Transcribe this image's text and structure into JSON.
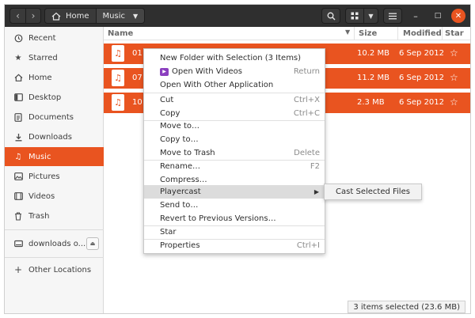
{
  "header": {
    "crumbs": [
      {
        "label": "Home",
        "icon": "home-icon"
      },
      {
        "label": "Music",
        "icon": "chevron-down-icon"
      }
    ]
  },
  "sidebar": {
    "items": [
      {
        "label": "Recent",
        "icon": "clock-icon"
      },
      {
        "label": "Starred",
        "icon": "star-icon"
      },
      {
        "label": "Home",
        "icon": "home-icon"
      },
      {
        "label": "Desktop",
        "icon": "desktop-icon"
      },
      {
        "label": "Documents",
        "icon": "document-icon"
      },
      {
        "label": "Downloads",
        "icon": "download-icon"
      },
      {
        "label": "Music",
        "icon": "music-note-icon",
        "active": true
      },
      {
        "label": "Pictures",
        "icon": "picture-icon"
      },
      {
        "label": "Videos",
        "icon": "video-icon"
      },
      {
        "label": "Trash",
        "icon": "trash-icon"
      }
    ],
    "drive": {
      "label": "downloads o...",
      "icon": "drive-icon"
    },
    "other": {
      "label": "Other Locations",
      "icon": "plus-icon"
    }
  },
  "columns": {
    "name": "Name",
    "size": "Size",
    "modified": "Modified",
    "star": "Star"
  },
  "files": [
    {
      "name": "01 - ",
      "size": "10.2 MB",
      "modified": "6 Sep 2012"
    },
    {
      "name": "07 - ",
      "size": "11.2 MB",
      "modified": "6 Sep 2012"
    },
    {
      "name": "10 - ",
      "size": "2.3 MB",
      "modified": "6 Sep 2012"
    }
  ],
  "context_menu": {
    "items": [
      {
        "label": "New Folder with Selection (3 Items)",
        "shortcut": ""
      },
      {
        "label": "Open With Videos",
        "shortcut": "Return"
      },
      {
        "label": "Open With Other Application",
        "shortcut": ""
      },
      {
        "label": "Cut",
        "shortcut": "Ctrl+X"
      },
      {
        "label": "Copy",
        "shortcut": "Ctrl+C"
      },
      {
        "label": "Move to…",
        "shortcut": ""
      },
      {
        "label": "Copy to…",
        "shortcut": ""
      },
      {
        "label": "Move to Trash",
        "shortcut": "Delete"
      },
      {
        "label": "Rename…",
        "shortcut": "F2"
      },
      {
        "label": "Compress…",
        "shortcut": ""
      },
      {
        "label": "Playercast",
        "shortcut": ""
      },
      {
        "label": "Send to…",
        "shortcut": ""
      },
      {
        "label": "Revert to Previous Versions…",
        "shortcut": ""
      },
      {
        "label": "Star",
        "shortcut": ""
      },
      {
        "label": "Properties",
        "shortcut": "Ctrl+I"
      }
    ],
    "submenu": "Cast Selected Files"
  },
  "status": "3 items selected  (23.6 MB)",
  "colors": {
    "accent": "#e95420",
    "headerbar": "#2f2f2f"
  }
}
